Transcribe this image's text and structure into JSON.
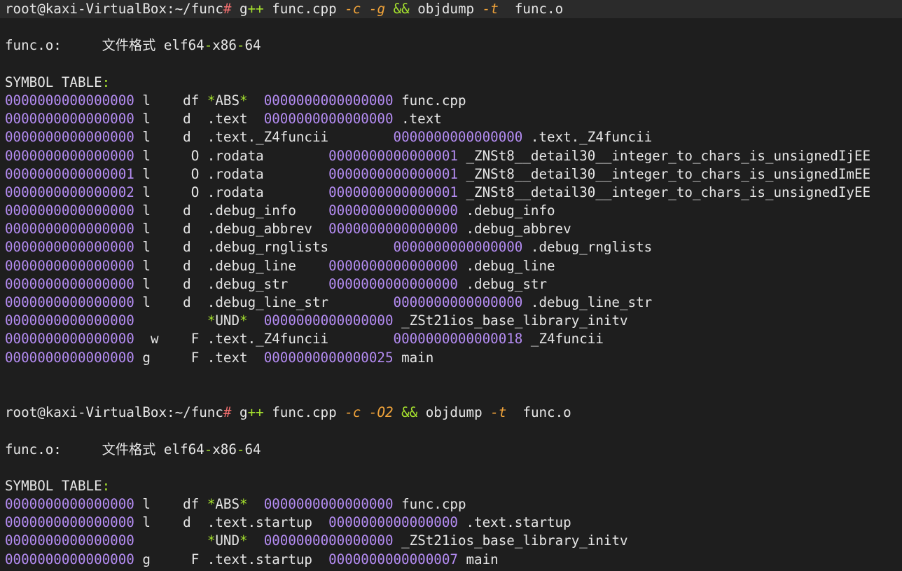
{
  "colors": {
    "background": "#1e1e1e",
    "text": "#e6e6e6",
    "hex_purple": "#b48cf2",
    "prompt_symbol": "#f06e6e",
    "operator_green": "#a6e22e",
    "flag_orange": "#f0a33a"
  },
  "lines": [
    {
      "segments": [
        {
          "t": "root@kaxi-VirtualBox:~/func",
          "c": "default"
        },
        {
          "t": "#",
          "c": "red"
        },
        {
          "t": " g",
          "c": "default"
        },
        {
          "t": "++",
          "c": "green"
        },
        {
          "t": " func.cpp ",
          "c": "default"
        },
        {
          "t": "-c",
          "c": "orange"
        },
        {
          "t": " ",
          "c": "default"
        },
        {
          "t": "-g",
          "c": "orange"
        },
        {
          "t": " ",
          "c": "default"
        },
        {
          "t": "&&",
          "c": "green"
        },
        {
          "t": " objdump ",
          "c": "default"
        },
        {
          "t": "-t",
          "c": "orange"
        },
        {
          "t": "  func.o",
          "c": "default"
        }
      ]
    },
    {
      "segments": []
    },
    {
      "segments": [
        {
          "t": "func.o:     ",
          "c": "default"
        },
        {
          "t": "文件格式",
          "c": "cjk"
        },
        {
          "t": " elf64",
          "c": "default"
        },
        {
          "t": "-",
          "c": "green"
        },
        {
          "t": "x86",
          "c": "default"
        },
        {
          "t": "-",
          "c": "green"
        },
        {
          "t": "64",
          "c": "default"
        }
      ]
    },
    {
      "segments": []
    },
    {
      "segments": [
        {
          "t": "SYMBOL TABLE",
          "c": "default"
        },
        {
          "t": ":",
          "c": "green"
        }
      ]
    },
    {
      "segments": [
        {
          "t": "0000000000000000",
          "c": "hex"
        },
        {
          "t": " l    df ",
          "c": "default"
        },
        {
          "t": "*",
          "c": "green"
        },
        {
          "t": "ABS",
          "c": "default"
        },
        {
          "t": "*",
          "c": "green"
        },
        {
          "t": "  ",
          "c": "default"
        },
        {
          "t": "0000000000000000",
          "c": "hex"
        },
        {
          "t": " func.cpp",
          "c": "default"
        }
      ]
    },
    {
      "segments": [
        {
          "t": "0000000000000000",
          "c": "hex"
        },
        {
          "t": " l    d  .text  ",
          "c": "default"
        },
        {
          "t": "0000000000000000",
          "c": "hex"
        },
        {
          "t": " .text",
          "c": "default"
        }
      ]
    },
    {
      "segments": [
        {
          "t": "0000000000000000",
          "c": "hex"
        },
        {
          "t": " l    d  .text._Z4funcii        ",
          "c": "default"
        },
        {
          "t": "0000000000000000",
          "c": "hex"
        },
        {
          "t": " .text._Z4funcii",
          "c": "default"
        }
      ]
    },
    {
      "segments": [
        {
          "t": "0000000000000000",
          "c": "hex"
        },
        {
          "t": " l     O .rodata        ",
          "c": "default"
        },
        {
          "t": "0000000000000001",
          "c": "hex"
        },
        {
          "t": " _ZNSt8__detail30__integer_to_chars_is_unsignedIjEE",
          "c": "default"
        }
      ]
    },
    {
      "segments": [
        {
          "t": "0000000000000001",
          "c": "hex"
        },
        {
          "t": " l     O .rodata        ",
          "c": "default"
        },
        {
          "t": "0000000000000001",
          "c": "hex"
        },
        {
          "t": " _ZNSt8__detail30__integer_to_chars_is_unsignedImEE",
          "c": "default"
        }
      ]
    },
    {
      "segments": [
        {
          "t": "0000000000000002",
          "c": "hex"
        },
        {
          "t": " l     O .rodata        ",
          "c": "default"
        },
        {
          "t": "0000000000000001",
          "c": "hex"
        },
        {
          "t": " _ZNSt8__detail30__integer_to_chars_is_unsignedIyEE",
          "c": "default"
        }
      ]
    },
    {
      "segments": [
        {
          "t": "0000000000000000",
          "c": "hex"
        },
        {
          "t": " l    d  .debug_info    ",
          "c": "default"
        },
        {
          "t": "0000000000000000",
          "c": "hex"
        },
        {
          "t": " .debug_info",
          "c": "default"
        }
      ]
    },
    {
      "segments": [
        {
          "t": "0000000000000000",
          "c": "hex"
        },
        {
          "t": " l    d  .debug_abbrev  ",
          "c": "default"
        },
        {
          "t": "0000000000000000",
          "c": "hex"
        },
        {
          "t": " .debug_abbrev",
          "c": "default"
        }
      ]
    },
    {
      "segments": [
        {
          "t": "0000000000000000",
          "c": "hex"
        },
        {
          "t": " l    d  .debug_rnglists        ",
          "c": "default"
        },
        {
          "t": "0000000000000000",
          "c": "hex"
        },
        {
          "t": " .debug_rnglists",
          "c": "default"
        }
      ]
    },
    {
      "segments": [
        {
          "t": "0000000000000000",
          "c": "hex"
        },
        {
          "t": " l    d  .debug_line    ",
          "c": "default"
        },
        {
          "t": "0000000000000000",
          "c": "hex"
        },
        {
          "t": " .debug_line",
          "c": "default"
        }
      ]
    },
    {
      "segments": [
        {
          "t": "0000000000000000",
          "c": "hex"
        },
        {
          "t": " l    d  .debug_str     ",
          "c": "default"
        },
        {
          "t": "0000000000000000",
          "c": "hex"
        },
        {
          "t": " .debug_str",
          "c": "default"
        }
      ]
    },
    {
      "segments": [
        {
          "t": "0000000000000000",
          "c": "hex"
        },
        {
          "t": " l    d  .debug_line_str        ",
          "c": "default"
        },
        {
          "t": "0000000000000000",
          "c": "hex"
        },
        {
          "t": " .debug_line_str",
          "c": "default"
        }
      ]
    },
    {
      "segments": [
        {
          "t": "0000000000000000",
          "c": "hex"
        },
        {
          "t": "         ",
          "c": "default"
        },
        {
          "t": "*",
          "c": "green"
        },
        {
          "t": "UND",
          "c": "default"
        },
        {
          "t": "*",
          "c": "green"
        },
        {
          "t": "  ",
          "c": "default"
        },
        {
          "t": "0000000000000000",
          "c": "hex"
        },
        {
          "t": " _ZSt21ios_base_library_initv",
          "c": "default"
        }
      ]
    },
    {
      "segments": [
        {
          "t": "0000000000000000",
          "c": "hex"
        },
        {
          "t": "  w    F .text._Z4funcii        ",
          "c": "default"
        },
        {
          "t": "0000000000000018",
          "c": "hex"
        },
        {
          "t": " _Z4funcii",
          "c": "default"
        }
      ]
    },
    {
      "segments": [
        {
          "t": "0000000000000000",
          "c": "hex"
        },
        {
          "t": " g     F .text  ",
          "c": "default"
        },
        {
          "t": "0000000000000025",
          "c": "hex"
        },
        {
          "t": " main",
          "c": "default"
        }
      ]
    },
    {
      "segments": []
    },
    {
      "segments": []
    },
    {
      "segments": [
        {
          "t": "root@kaxi-VirtualBox:~/func",
          "c": "default"
        },
        {
          "t": "#",
          "c": "red"
        },
        {
          "t": " g",
          "c": "default"
        },
        {
          "t": "++",
          "c": "green"
        },
        {
          "t": " func.cpp ",
          "c": "default"
        },
        {
          "t": "-c",
          "c": "orange"
        },
        {
          "t": " ",
          "c": "default"
        },
        {
          "t": "-O2",
          "c": "orange"
        },
        {
          "t": " ",
          "c": "default"
        },
        {
          "t": "&&",
          "c": "green"
        },
        {
          "t": " objdump ",
          "c": "default"
        },
        {
          "t": "-t",
          "c": "orange"
        },
        {
          "t": "  func.o",
          "c": "default"
        }
      ]
    },
    {
      "segments": []
    },
    {
      "segments": [
        {
          "t": "func.o:     ",
          "c": "default"
        },
        {
          "t": "文件格式",
          "c": "cjk"
        },
        {
          "t": " elf64",
          "c": "default"
        },
        {
          "t": "-",
          "c": "green"
        },
        {
          "t": "x86",
          "c": "default"
        },
        {
          "t": "-",
          "c": "green"
        },
        {
          "t": "64",
          "c": "default"
        }
      ]
    },
    {
      "segments": []
    },
    {
      "segments": [
        {
          "t": "SYMBOL TABLE",
          "c": "default"
        },
        {
          "t": ":",
          "c": "green"
        }
      ]
    },
    {
      "segments": [
        {
          "t": "0000000000000000",
          "c": "hex"
        },
        {
          "t": " l    df ",
          "c": "default"
        },
        {
          "t": "*",
          "c": "green"
        },
        {
          "t": "ABS",
          "c": "default"
        },
        {
          "t": "*",
          "c": "green"
        },
        {
          "t": "  ",
          "c": "default"
        },
        {
          "t": "0000000000000000",
          "c": "hex"
        },
        {
          "t": " func.cpp",
          "c": "default"
        }
      ]
    },
    {
      "segments": [
        {
          "t": "0000000000000000",
          "c": "hex"
        },
        {
          "t": " l    d  .text.startup  ",
          "c": "default"
        },
        {
          "t": "0000000000000000",
          "c": "hex"
        },
        {
          "t": " .text.startup",
          "c": "default"
        }
      ]
    },
    {
      "segments": [
        {
          "t": "0000000000000000",
          "c": "hex"
        },
        {
          "t": "         ",
          "c": "default"
        },
        {
          "t": "*",
          "c": "green"
        },
        {
          "t": "UND",
          "c": "default"
        },
        {
          "t": "*",
          "c": "green"
        },
        {
          "t": "  ",
          "c": "default"
        },
        {
          "t": "0000000000000000",
          "c": "hex"
        },
        {
          "t": " _ZSt21ios_base_library_initv",
          "c": "default"
        }
      ]
    },
    {
      "segments": [
        {
          "t": "0000000000000000",
          "c": "hex"
        },
        {
          "t": " g     F .text.startup  ",
          "c": "default"
        },
        {
          "t": "0000000000000007",
          "c": "hex"
        },
        {
          "t": " main",
          "c": "default"
        }
      ]
    }
  ]
}
